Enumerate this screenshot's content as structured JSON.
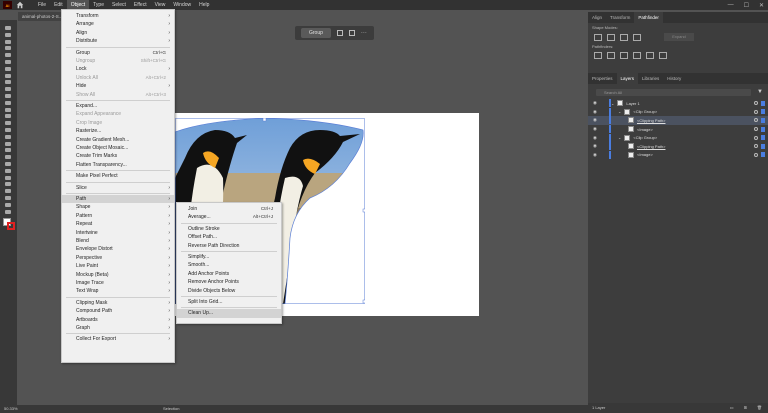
{
  "menubar": {
    "app_icon": "Ai",
    "home_icon": "home-icon",
    "items": [
      "File",
      "Edit",
      "Object",
      "Type",
      "Select",
      "Effect",
      "View",
      "Window",
      "Help"
    ],
    "active": "Object"
  },
  "document": {
    "tab_label": "animal-photos-2-S..."
  },
  "context_bar": {
    "group_label": "Group",
    "more": "···"
  },
  "object_menu": [
    {
      "label": "Transform",
      "arrow": true
    },
    {
      "label": "Arrange",
      "arrow": true
    },
    {
      "label": "Align",
      "arrow": true
    },
    {
      "label": "Distribute",
      "arrow": true
    },
    {
      "sep": true
    },
    {
      "label": "Group",
      "shortcut": "Ctrl+G"
    },
    {
      "label": "Ungroup",
      "shortcut": "Shift+Ctrl+G",
      "disabled": true
    },
    {
      "label": "Lock",
      "arrow": true
    },
    {
      "label": "Unlock All",
      "shortcut": "Alt+Ctrl+2",
      "disabled": true
    },
    {
      "label": "Hide",
      "arrow": true
    },
    {
      "label": "Show All",
      "shortcut": "Alt+Ctrl+3",
      "disabled": true
    },
    {
      "sep": true
    },
    {
      "label": "Expand..."
    },
    {
      "label": "Expand Appearance",
      "disabled": true
    },
    {
      "label": "Crop Image",
      "disabled": true
    },
    {
      "label": "Rasterize..."
    },
    {
      "label": "Create Gradient Mesh..."
    },
    {
      "label": "Create Object Mosaic..."
    },
    {
      "label": "Create Trim Marks"
    },
    {
      "label": "Flatten Transparency..."
    },
    {
      "sep": true
    },
    {
      "label": "Make Pixel Perfect"
    },
    {
      "sep": true
    },
    {
      "label": "Slice",
      "arrow": true
    },
    {
      "sep": true
    },
    {
      "label": "Path",
      "arrow": true,
      "highlight": true
    },
    {
      "label": "Shape",
      "arrow": true
    },
    {
      "label": "Pattern",
      "arrow": true
    },
    {
      "label": "Repeat",
      "arrow": true
    },
    {
      "label": "Intertwine",
      "arrow": true
    },
    {
      "label": "Blend",
      "arrow": true
    },
    {
      "label": "Envelope Distort",
      "arrow": true
    },
    {
      "label": "Perspective",
      "arrow": true
    },
    {
      "label": "Live Paint",
      "arrow": true
    },
    {
      "label": "Mockup (Beta)",
      "arrow": true
    },
    {
      "label": "Image Trace",
      "arrow": true
    },
    {
      "label": "Text Wrap",
      "arrow": true
    },
    {
      "sep": true
    },
    {
      "label": "Clipping Mask",
      "arrow": true
    },
    {
      "label": "Compound Path",
      "arrow": true
    },
    {
      "label": "Artboards",
      "arrow": true
    },
    {
      "label": "Graph",
      "arrow": true
    },
    {
      "sep": true
    },
    {
      "label": "Collect For Export",
      "arrow": true
    }
  ],
  "path_submenu": [
    {
      "label": "Join",
      "shortcut": "Ctrl+J"
    },
    {
      "label": "Average...",
      "shortcut": "Alt+Ctrl+J"
    },
    {
      "sep": true
    },
    {
      "label": "Outline Stroke"
    },
    {
      "label": "Offset Path..."
    },
    {
      "label": "Reverse Path Direction"
    },
    {
      "sep": true
    },
    {
      "label": "Simplify..."
    },
    {
      "label": "Smooth..."
    },
    {
      "label": "Add Anchor Points"
    },
    {
      "label": "Remove Anchor Points"
    },
    {
      "label": "Divide Objects Below"
    },
    {
      "sep": true
    },
    {
      "label": "Split Into Grid..."
    },
    {
      "sep": true
    },
    {
      "label": "Clean Up...",
      "highlight": true
    }
  ],
  "top_panel": {
    "tabs": [
      "Align",
      "Transform",
      "Pathfinder"
    ],
    "active": "Pathfinder",
    "shape_modes_label": "Shape Modes:",
    "pathfinders_label": "Pathfinders:",
    "expand_label": "Expand"
  },
  "layers_panel": {
    "tabs": [
      "Properties",
      "Layers",
      "Libraries",
      "History"
    ],
    "active": "Layers",
    "search_placeholder": "Search All",
    "rows": [
      {
        "name": "Layer 1",
        "underline": false,
        "selected": false
      },
      {
        "name": "<Clip Group>",
        "underline": false,
        "selected": false
      },
      {
        "name": "<Clipping Path>",
        "underline": true,
        "selected": true
      },
      {
        "name": "<Image>",
        "underline": false,
        "selected": false
      },
      {
        "name": "<Clip Group>",
        "underline": false,
        "selected": false
      },
      {
        "name": "<Clipping Path>",
        "underline": true,
        "selected": false
      },
      {
        "name": "<Image>",
        "underline": false,
        "selected": false
      }
    ],
    "footer": "1 Layer"
  },
  "status_bar": {
    "zoom": "50.33%",
    "selection_label": "Selection"
  },
  "colors": {
    "accent": "#4a7de0",
    "menu_bg": "#f0f0f0",
    "ui_bg": "#535353"
  }
}
